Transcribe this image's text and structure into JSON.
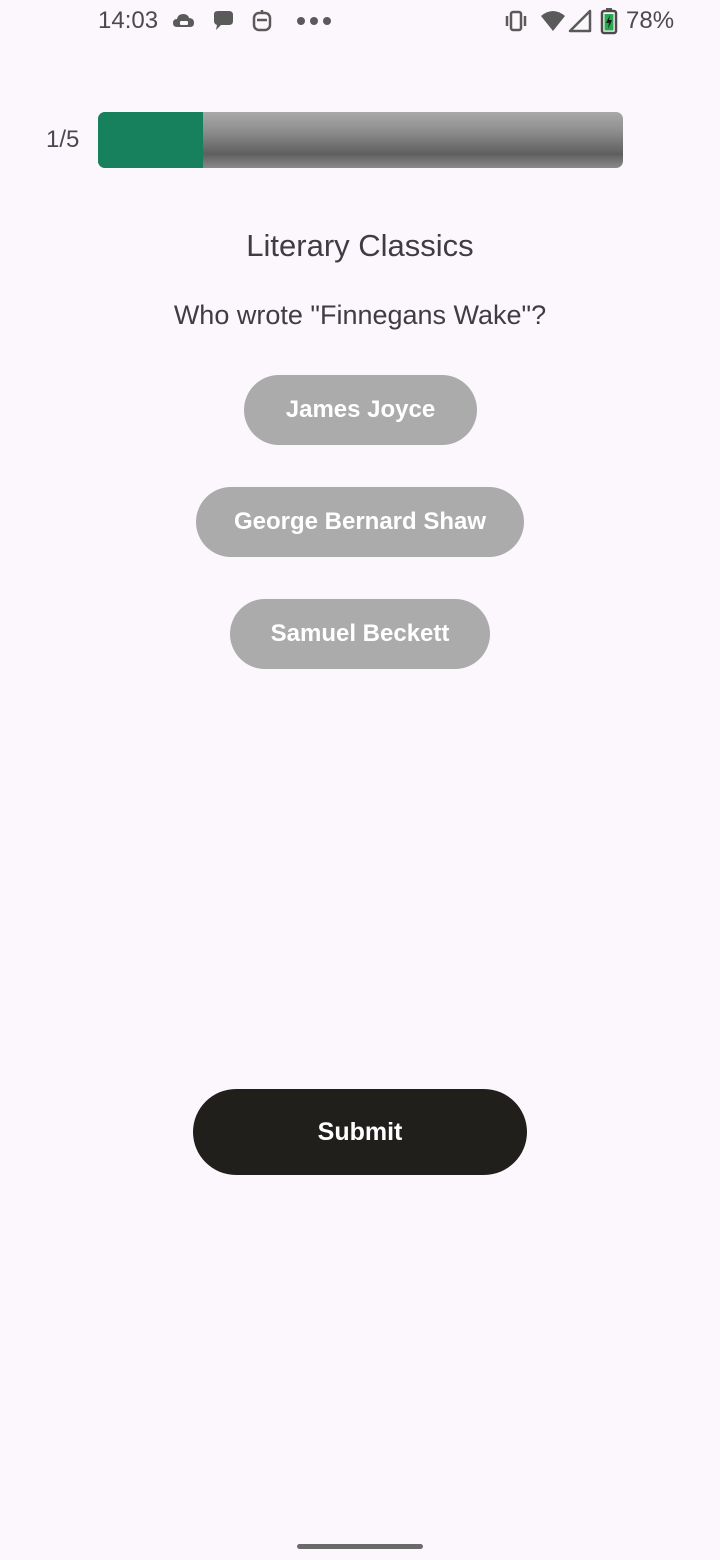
{
  "status_bar": {
    "time": "14:03",
    "battery_percent": "78%",
    "left_icons": [
      "cloud-game-icon",
      "chat-bubble-icon",
      "robot-face-icon",
      "more-dots-icon"
    ],
    "right_icons": [
      "vibrate-icon",
      "wifi-icon",
      "signal-icon",
      "battery-charging-icon"
    ]
  },
  "progress": {
    "label": "1/5",
    "fraction": 0.2,
    "fill_color": "#17815e",
    "track_color": "#8d8d8d"
  },
  "quiz": {
    "title": "Literary Classics",
    "question": "Who wrote \"Finnegans Wake\"?",
    "answers": [
      {
        "label": "James Joyce"
      },
      {
        "label": "George Bernard Shaw"
      },
      {
        "label": "Samuel Beckett"
      }
    ],
    "submit_label": "Submit"
  },
  "colors": {
    "background": "#fcf7fc",
    "answer_button": "#ababab",
    "submit_button": "#211f1c"
  }
}
